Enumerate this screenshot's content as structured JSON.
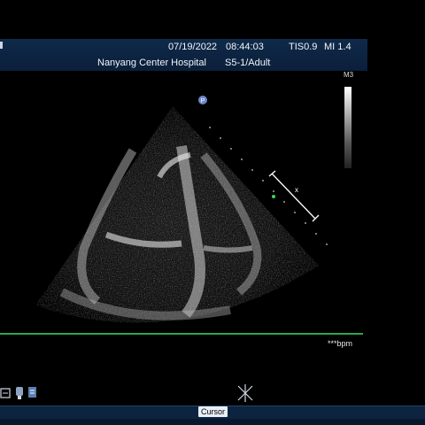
{
  "header": {
    "date": "07/19/2022",
    "time": "08:44:03",
    "tis": "TIS0.9",
    "mi": "MI 1.4",
    "hospital": "Nanyang Center Hospital",
    "probe_preset": "S5-1/Adult"
  },
  "image": {
    "focus_marker": "P",
    "gray_map_label": "M3",
    "measure_marker": "x"
  },
  "heart_rate": {
    "value_text": "***bpm"
  },
  "toolbar": {
    "icons": [
      "caliper-icon",
      "probe-icon",
      "report-icon"
    ],
    "freeze_icon": "freeze-cross-icon"
  },
  "status": {
    "mode_label": "Cursor"
  },
  "colors": {
    "header_bg": "#0f2a4a",
    "baseline": "#2aa84a",
    "status_bg": "#0c2440",
    "focus_marker": "#6f86c9",
    "measure_line": "#ffffff"
  }
}
